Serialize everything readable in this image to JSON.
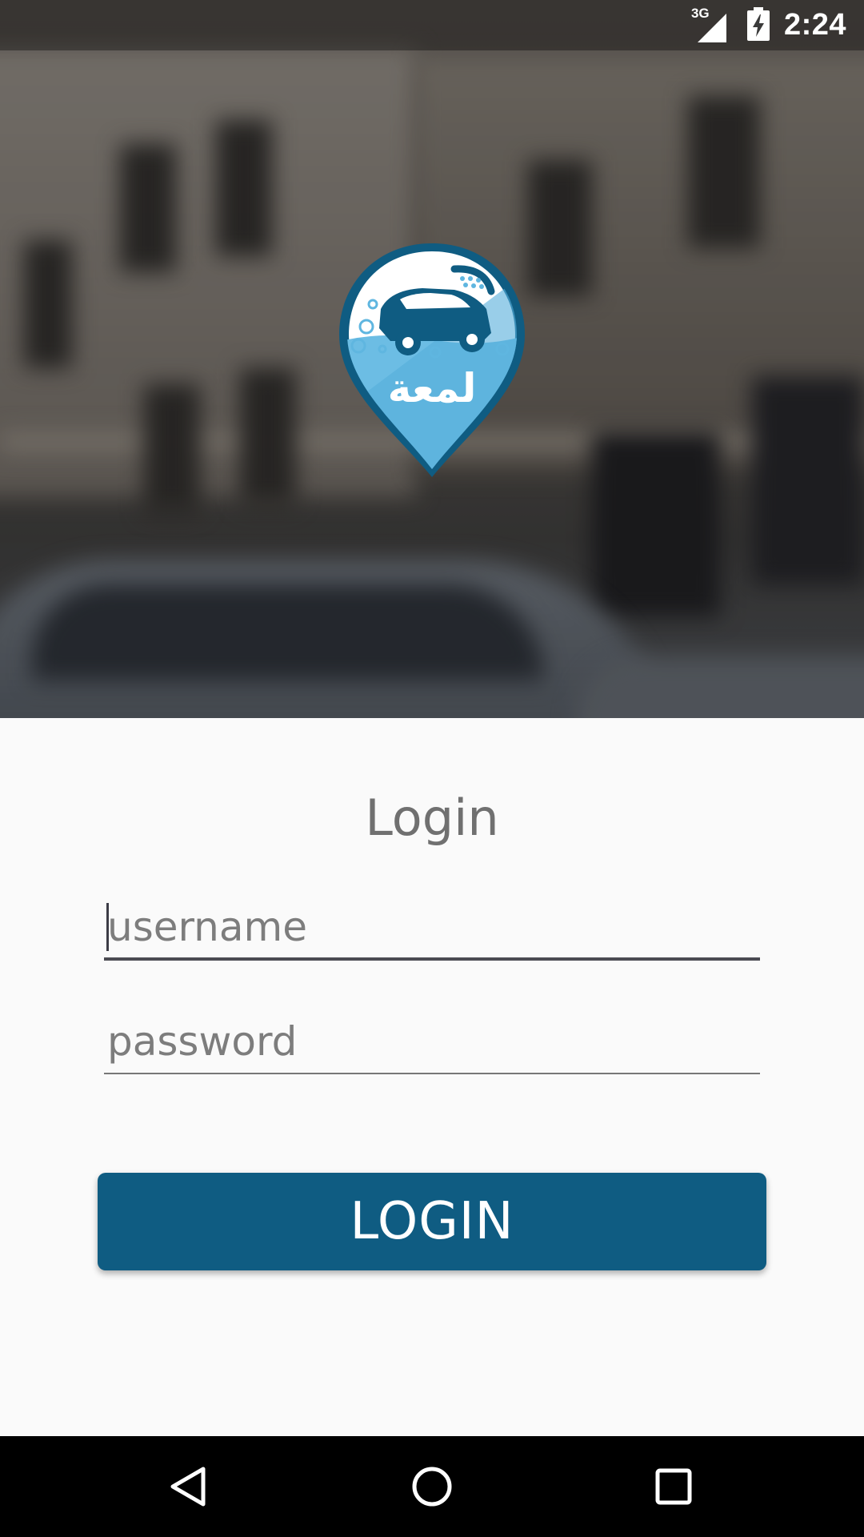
{
  "status_bar": {
    "network_label": "3G",
    "time": "2:24",
    "icons": [
      "network-3g-icon",
      "signal-icon",
      "battery-charging-icon"
    ]
  },
  "logo": {
    "wordmark": "لمعة",
    "brand_color": "#0f5c82",
    "accent_color": "#5fb6e0"
  },
  "form": {
    "title": "Login",
    "username_placeholder": "username",
    "password_placeholder": "password",
    "username_value": "",
    "password_value": "",
    "login_label": "LOGIN"
  },
  "nav_bar": {
    "icons": [
      "back-icon",
      "home-icon",
      "recent-apps-icon"
    ]
  }
}
